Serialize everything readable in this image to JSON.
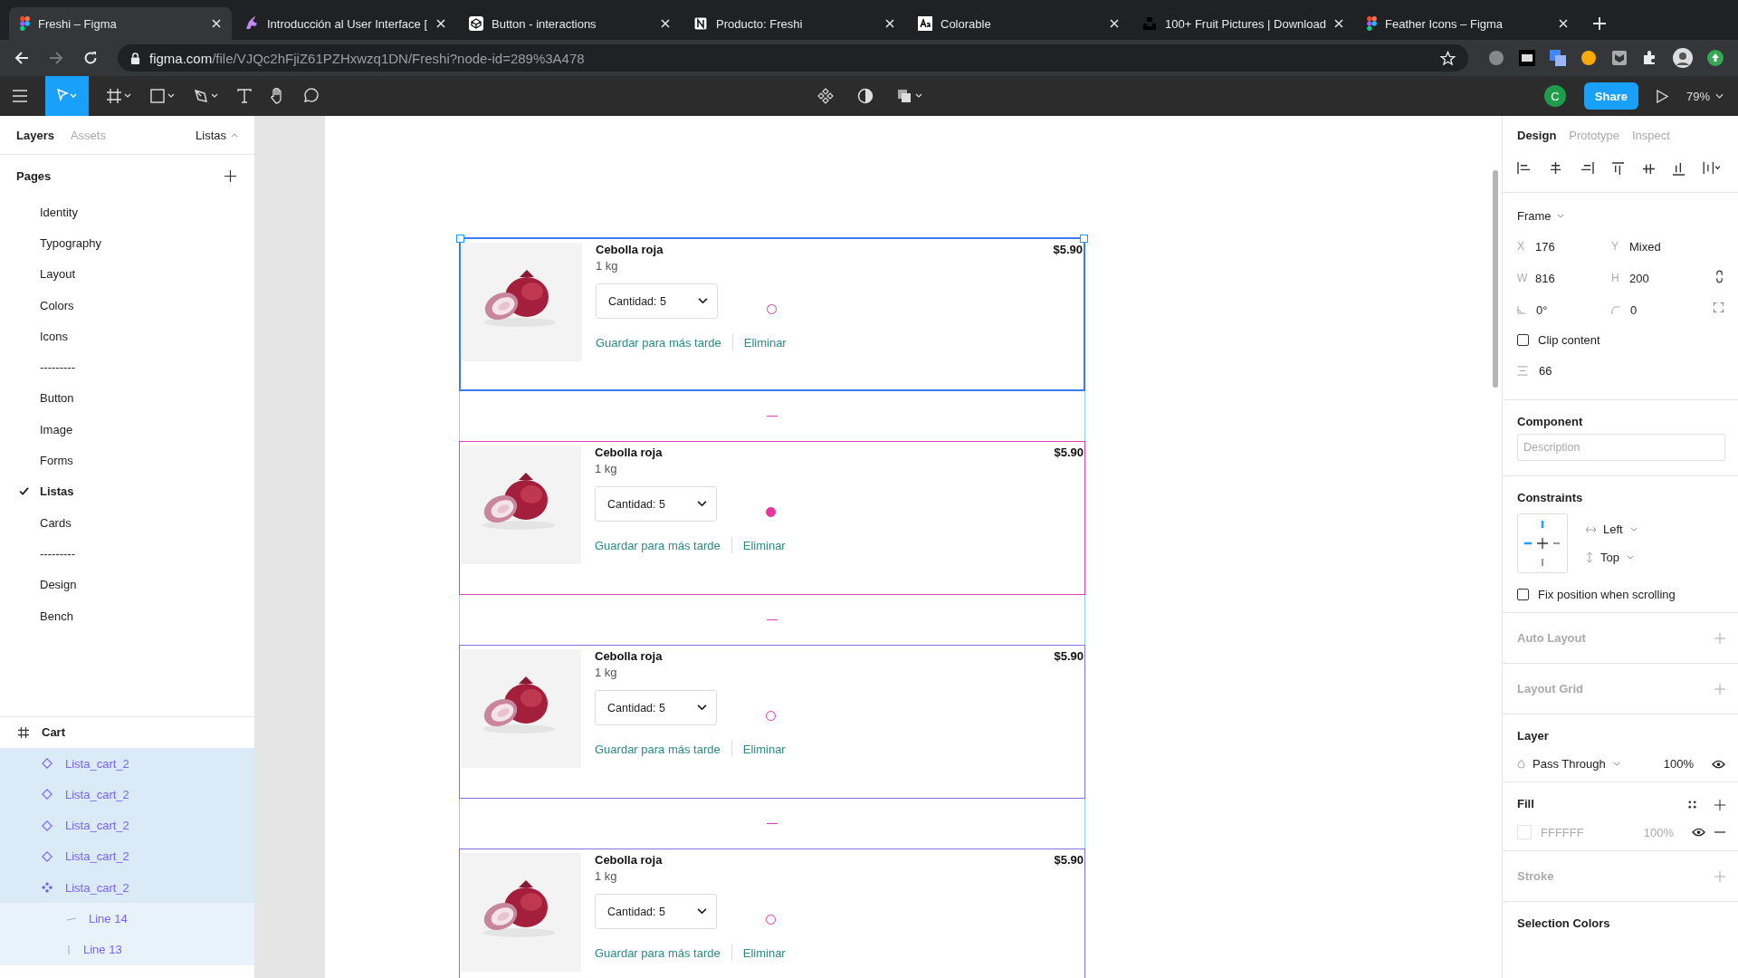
{
  "browser": {
    "tabs": [
      {
        "title": "Freshi – Figma",
        "selected": true
      },
      {
        "title": "Introducción al User Interface [",
        "selected": false
      },
      {
        "title": "Button - interactions",
        "selected": false
      },
      {
        "title": "Producto: Freshi",
        "selected": false
      },
      {
        "title": "Colorable",
        "selected": false
      },
      {
        "title": "100+ Fruit Pictures | Download",
        "selected": false
      },
      {
        "title": "Feather Icons – Figma",
        "selected": false
      }
    ],
    "url_host": "figma.com",
    "url_path": "/file/VJQc2hFjiZ61PZHxwzq1DN/Freshi?node-id=289%3A478"
  },
  "toolbar": {
    "avatar": "C",
    "share": "Share",
    "zoom": "79%"
  },
  "left_panel": {
    "tabs": [
      {
        "label": "Layers",
        "selected": true
      },
      {
        "label": "Assets",
        "selected": false
      }
    ],
    "page_menu": "Listas",
    "pages_title": "Pages",
    "pages": [
      {
        "label": "Identity",
        "selected": false
      },
      {
        "label": "Typography",
        "selected": false
      },
      {
        "label": "Layout",
        "selected": false
      },
      {
        "label": "Colors",
        "selected": false
      },
      {
        "label": "Icons",
        "selected": false
      },
      {
        "label": "---------",
        "selected": false
      },
      {
        "label": "Button",
        "selected": false
      },
      {
        "label": "Image",
        "selected": false
      },
      {
        "label": "Forms",
        "selected": false
      },
      {
        "label": "Listas",
        "selected": true
      },
      {
        "label": "Cards",
        "selected": false
      },
      {
        "label": "---------",
        "selected": false
      },
      {
        "label": "Design",
        "selected": false
      },
      {
        "label": "Bench",
        "selected": false
      }
    ],
    "layers": [
      {
        "name": "Cart",
        "kind": "frame",
        "selected": false,
        "children": [
          {
            "name": "Lista_cart_2",
            "kind": "instance",
            "selected": true
          },
          {
            "name": "Lista_cart_2",
            "kind": "instance",
            "selected": true
          },
          {
            "name": "Lista_cart_2",
            "kind": "instance",
            "selected": true
          },
          {
            "name": "Lista_cart_2",
            "kind": "instance",
            "selected": true
          },
          {
            "name": "Lista_cart_2",
            "kind": "component",
            "selected": true,
            "children": [
              {
                "name": "Line 14",
                "kind": "hline",
                "selected": false
              },
              {
                "name": "Line 13",
                "kind": "vline",
                "selected": false
              }
            ]
          }
        ]
      }
    ]
  },
  "canvas": {
    "cards": [
      {
        "title": "Cebolla roja",
        "weight": "1 kg",
        "quantity": "Cantidad: 5",
        "save_link": "Guardar para más tarde",
        "delete_link": "Eliminar",
        "price": "$5.90",
        "selected": true,
        "hovered": false
      },
      {
        "title": "Cebolla roja",
        "weight": "1 kg",
        "quantity": "Cantidad: 5",
        "save_link": "Guardar para más tarde",
        "delete_link": "Eliminar",
        "price": "$5.90",
        "selected": false,
        "hovered": true
      },
      {
        "title": "Cebolla roja",
        "weight": "1 kg",
        "quantity": "Cantidad: 5",
        "save_link": "Guardar para más tarde",
        "delete_link": "Eliminar",
        "price": "$5.90",
        "selected": false,
        "hovered": false
      },
      {
        "title": "Cebolla roja",
        "weight": "1 kg",
        "quantity": "Cantidad: 5",
        "save_link": "Guardar para más tarde",
        "delete_link": "Eliminar",
        "price": "$5.90",
        "selected": false,
        "hovered": false
      }
    ]
  },
  "right_panel": {
    "tabs": [
      {
        "label": "Design",
        "selected": true
      },
      {
        "label": "Prototype",
        "selected": false
      },
      {
        "label": "Inspect",
        "selected": false
      }
    ],
    "frame_menu": "Frame",
    "fields": [
      {
        "label": "X",
        "value": "176"
      },
      {
        "label": "Y",
        "value": "Mixed"
      },
      {
        "label": "W",
        "value": "816"
      },
      {
        "label": "H",
        "value": "200"
      }
    ],
    "rotation": "0°",
    "radius": "0",
    "clip_content": {
      "label": "Clip content",
      "checked": false
    },
    "spacing": "66",
    "component": {
      "title": "Component",
      "placeholder": "Description"
    },
    "constraints": {
      "title": "Constraints",
      "horizontal": "Left",
      "vertical": "Top"
    },
    "fix_position": {
      "label": "Fix position when scrolling",
      "checked": false
    },
    "sections": [
      {
        "title": "Auto Layout",
        "empty": true
      },
      {
        "title": "Layout Grid",
        "empty": true
      }
    ],
    "layer": {
      "title": "Layer",
      "blend": "Pass Through",
      "opacity": "100%"
    },
    "fill": {
      "title": "Fill",
      "hex": "FFFFFF",
      "opacity": "100%"
    },
    "stroke": {
      "title": "Stroke",
      "empty": true
    },
    "selection_colors": {
      "title": "Selection Colors"
    }
  }
}
